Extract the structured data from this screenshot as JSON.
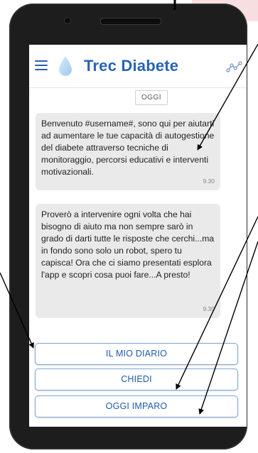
{
  "app": {
    "title": "Trec Diabete"
  },
  "chat": {
    "date_label": "OGGI",
    "messages": [
      {
        "text": "Benvenuto #username#, sono qui per aiutarti ad aumentare le tue capacità di autogestione del  diabete  attraverso tecniche di monitoraggio,  percorsi educativi e interventi motivazionali.",
        "time": "9.30"
      },
      {
        "text": "Proverò a intervenire ogni volta che hai bisogno di aiuto ma non sempre sarò in grado di darti tutte le risposte che cerchi...ma in fondo sono solo un robot, spero tu capisca! Ora che ci siamo presentati  esplora l'app  e scopri cosa puoi fare...A presto!",
        "time": "9.30"
      }
    ]
  },
  "actions": {
    "diary_label": "IL MIO DIARIO",
    "ask_label": "CHIEDI",
    "learn_label": "OGGI IMPARO"
  },
  "icons": {
    "menu": "hamburger-menu-icon",
    "logo": "water-drop-icon",
    "chart": "line-graph-icon"
  },
  "colors": {
    "accent": "#2a64b4",
    "button_border": "#7fa6d6",
    "bubble_bg": "#eaeaea",
    "phone_body": "#1d1d1d"
  }
}
